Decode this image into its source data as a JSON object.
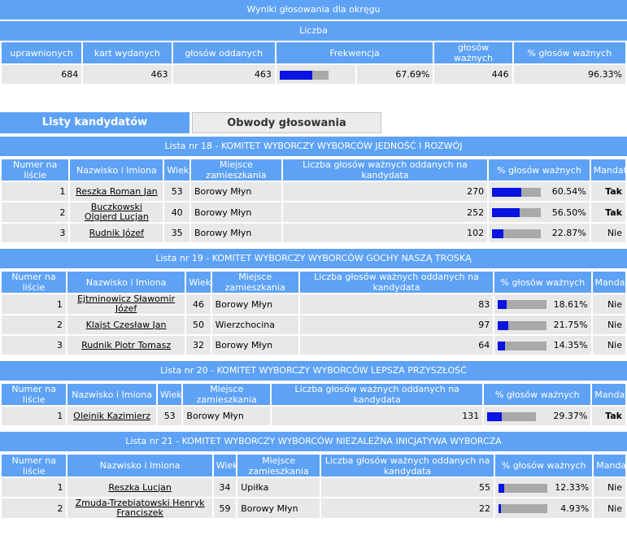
{
  "summary": {
    "title": "Wyniki głosowania dla okręgu",
    "group": "Liczba",
    "headers": [
      "uprawnionych",
      "kart wydanych",
      "głosów oddanych",
      "Frekwencja",
      "głosów ważnych",
      "% głosów ważnych"
    ],
    "values": {
      "uprawnionych": "684",
      "kart_wydanych": "463",
      "glosow_oddanych": "463",
      "frekwencja": "67.69%",
      "frekwencja_fraction": 0.6769,
      "glosow_waznych": "446",
      "procent_waznych": "96.33%"
    }
  },
  "tabs": {
    "active": "Listy kandydatów",
    "inactive": "Obwody głosowania"
  },
  "columns": [
    "Numer na liście",
    "Nazwisko i Imiona",
    "Wiek",
    "Miejsce zamieszkania",
    "Liczba głosów ważnych oddanych na kandydata",
    "% głosów ważnych",
    "Mandat"
  ],
  "lists": [
    {
      "title": "Lista nr 18 - KOMITET WYBORCZY WYBORCÓW JEDNOŚĆ I ROZWÓJ",
      "candidates": [
        {
          "num": "1",
          "name": "Reszka Roman Jan",
          "age": "53",
          "place": "Borowy Młyn",
          "votes": "270",
          "pct": "60.54%",
          "frac": 0.6054,
          "mandat": "Tak"
        },
        {
          "num": "2",
          "name": "Buczkowski Olgierd Lucjan",
          "age": "40",
          "place": "Borowy Młyn",
          "votes": "252",
          "pct": "56.50%",
          "frac": 0.565,
          "mandat": "Tak"
        },
        {
          "num": "3",
          "name": "Rudnik Józef",
          "age": "35",
          "place": "Borowy Młyn",
          "votes": "102",
          "pct": "22.87%",
          "frac": 0.2287,
          "mandat": "Nie"
        }
      ]
    },
    {
      "title": "Lista nr 19 - KOMITET WYBORCZY WYBORCÓW GOCHY NASZĄ TROSKĄ",
      "candidates": [
        {
          "num": "1",
          "name": "Ejtminowicz Sławomir Józef",
          "age": "46",
          "place": "Borowy Młyn",
          "votes": "83",
          "pct": "18.61%",
          "frac": 0.1861,
          "mandat": "Nie"
        },
        {
          "num": "2",
          "name": "Klajst Czesław Jan",
          "age": "50",
          "place": "Wierzchocina",
          "votes": "97",
          "pct": "21.75%",
          "frac": 0.2175,
          "mandat": "Nie"
        },
        {
          "num": "3",
          "name": "Rudnik Piotr Tomasz",
          "age": "32",
          "place": "Borowy Młyn",
          "votes": "64",
          "pct": "14.35%",
          "frac": 0.1435,
          "mandat": "Nie"
        }
      ]
    },
    {
      "title": "Lista nr 20 - KOMITET WYBORCZY WYBORCÓW LEPSZA PRZYSZŁOŚĆ",
      "candidates": [
        {
          "num": "1",
          "name": "Olejnik Kazimierz",
          "age": "53",
          "place": "Borowy Młyn",
          "votes": "131",
          "pct": "29.37%",
          "frac": 0.2937,
          "mandat": "Tak"
        }
      ]
    },
    {
      "title": "Lista nr 21 - KOMITET WYBORCZY WYBORCÓW NIEZALEŻNA INICJATYWA WYBORCZA",
      "candidates": [
        {
          "num": "1",
          "name": "Reszka Lucjan",
          "age": "34",
          "place": "Upiłka",
          "votes": "55",
          "pct": "12.33%",
          "frac": 0.1233,
          "mandat": "Nie"
        },
        {
          "num": "2",
          "name": "Zmuda-Trzebiatowski Henryk Franciszek",
          "age": "59",
          "place": "Borowy Młyn",
          "votes": "22",
          "pct": "4.93%",
          "frac": 0.0493,
          "mandat": "Nie"
        }
      ]
    }
  ]
}
